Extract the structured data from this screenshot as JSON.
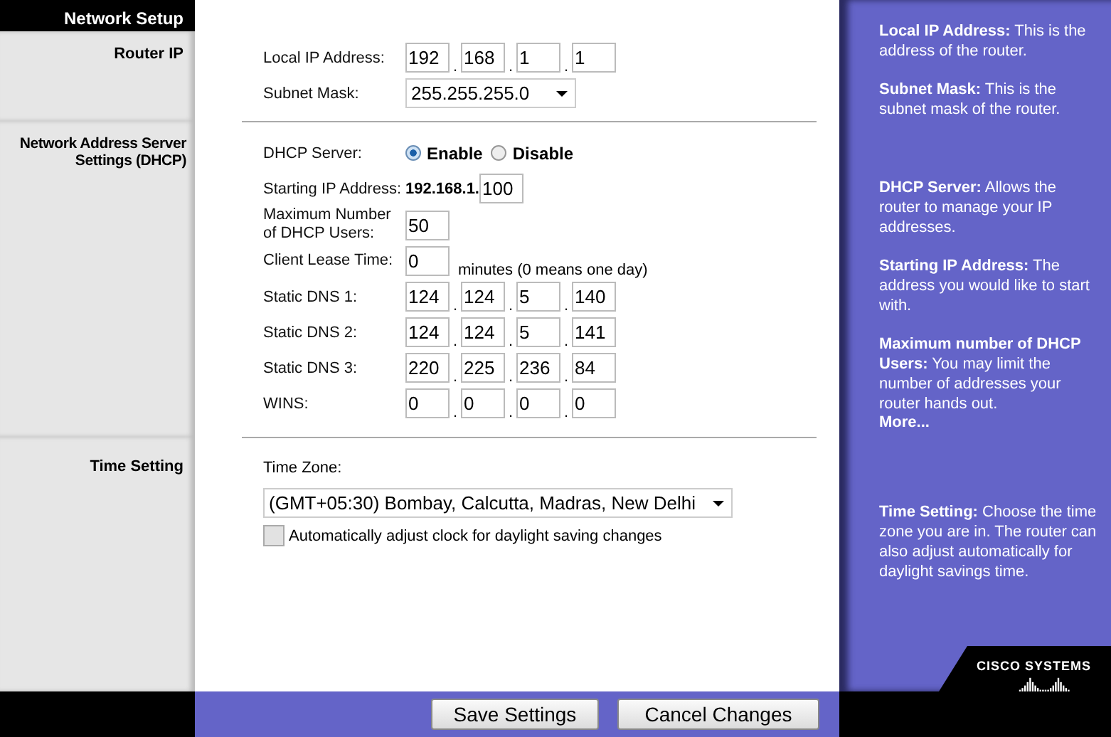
{
  "header": {
    "title": "Network Setup"
  },
  "sections": [
    {
      "label": "Router IP",
      "rows": [
        {
          "kind": "ip",
          "label": "Local IP Address:",
          "octets": [
            "192",
            "168",
            "1",
            "1"
          ]
        },
        {
          "kind": "select",
          "label": "Subnet Mask:",
          "value": "255.255.255.0"
        }
      ]
    },
    {
      "label": "Network Address Server Settings (DHCP)",
      "rows": [
        {
          "kind": "radio",
          "label": "DHCP Server:",
          "options": [
            {
              "label": "Enable",
              "selected": true
            },
            {
              "label": "Disable",
              "selected": false
            }
          ]
        },
        {
          "kind": "prefixed",
          "label": "Starting IP Address:",
          "prefix": "192.168.1.",
          "value": "100"
        },
        {
          "kind": "text",
          "label": "Maximum Number of DHCP Users:",
          "value": "50"
        },
        {
          "kind": "text",
          "label": "Client Lease Time:",
          "value": "0",
          "suffix": "minutes (0 means one day)"
        },
        {
          "kind": "ip",
          "label": "Static DNS 1:",
          "octets": [
            "124",
            "124",
            "5",
            "140"
          ]
        },
        {
          "kind": "ip",
          "label": "Static DNS 2:",
          "octets": [
            "124",
            "124",
            "5",
            "141"
          ]
        },
        {
          "kind": "ip",
          "label": "Static DNS 3:",
          "octets": [
            "220",
            "225",
            "236",
            "84"
          ]
        },
        {
          "kind": "ip",
          "label": "WINS:",
          "octets": [
            "0",
            "0",
            "0",
            "0"
          ]
        }
      ]
    },
    {
      "label": "Time Setting",
      "rows": [
        {
          "kind": "caption",
          "label": "Time Zone:"
        },
        {
          "kind": "wideselect",
          "value": "(GMT+05:30) Bombay, Calcutta, Madras, New Delhi"
        },
        {
          "kind": "checkbox",
          "label": "Automatically adjust clock for daylight saving changes",
          "checked": false
        }
      ]
    }
  ],
  "help": [
    [
      "**Local IP Address:** This is the address of the router.",
      "**Subnet Mask:** This is the subnet mask of the router."
    ],
    [
      "**DHCP Server:** Allows the router to manage your IP addresses.",
      "**Starting IP Address:** The address you would like to start with.",
      "**Maximum number of DHCP Users:** You may limit the number of addresses your router hands out."
    ],
    [
      "**Time Setting:** Choose the time zone you are in. The router can also adjust automatically for daylight savings time."
    ]
  ],
  "ip_separator": ".",
  "help_more": "More...",
  "logo": "CISCO SYSTEMS",
  "buttons": [
    "Save Settings",
    "Cancel Changes"
  ]
}
